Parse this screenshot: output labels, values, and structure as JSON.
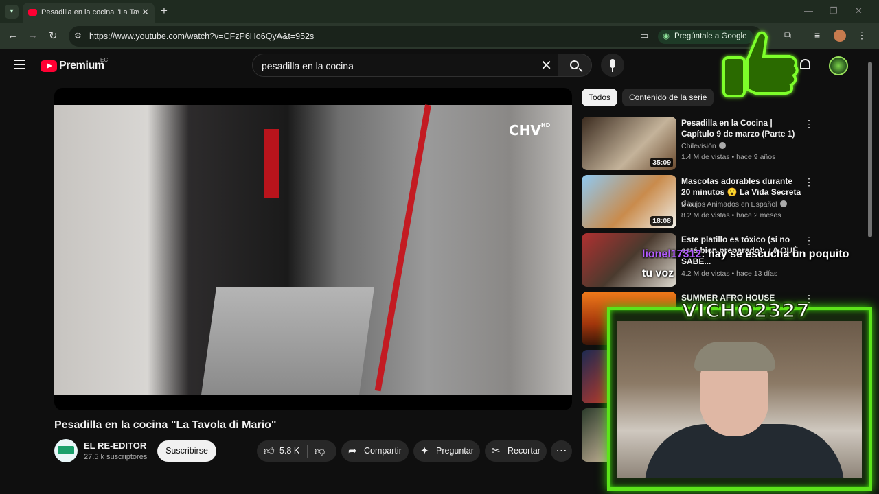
{
  "browser": {
    "tab_title": "Pesadilla en la cocina \"La Tavola",
    "url": "https://www.youtube.com/watch?v=CFzP6Ho6QyA&t=952s",
    "ask_google": "Pregúntale a Google"
  },
  "youtube": {
    "logo": "Premium",
    "country_code": "EC",
    "search_query": "pesadilla en la cocina"
  },
  "player": {
    "logo_text": "CHV",
    "logo_hd": "HD"
  },
  "video": {
    "title": "Pesadilla en la cocina \"La Tavola di Mario\"",
    "channel": "EL RE-EDITOR",
    "subscribers": "27.5 k suscriptores",
    "subscribe_label": "Suscribirse",
    "likes": "5.8 K",
    "share_label": "Compartir",
    "ask_label": "Preguntar",
    "clip_label": "Recortar"
  },
  "sidebar": {
    "chips": [
      "Todos",
      "Contenido de la serie"
    ],
    "recommendations": [
      {
        "title": "Pesadilla en la Cocina | Capítulo 9 de marzo (Parte 1)",
        "channel": "Chilevisión",
        "meta": "1.4 M de vistas • hace 9 años",
        "duration": "35:09"
      },
      {
        "title": "Mascotas adorables durante 20 minutos 😮 La Vida Secreta d...",
        "channel": "Dibujos Animados en Español",
        "meta": "8.2 M de vistas • hace 2 meses",
        "duration": "18:08"
      },
      {
        "title": "Este platillo es tóxico (si no está bien preparado): ¿A QUÉ SABE...",
        "channel": "",
        "meta": "4.2 M de vistas • hace 13 días",
        "duration": ""
      },
      {
        "title": "SUMMER AFRO HOUSE Sunset",
        "channel": "",
        "meta": "",
        "duration": ""
      }
    ]
  },
  "overlay": {
    "chat_user": "lionel17312",
    "chat_message": ": hay se escucha un poquito",
    "chat_message_2": "tu voz",
    "streamer_name": "VICHO2327"
  },
  "colors": {
    "accent_red": "#ff0033",
    "neon_green": "#5ce41a",
    "chat_user": "#b35cff"
  }
}
